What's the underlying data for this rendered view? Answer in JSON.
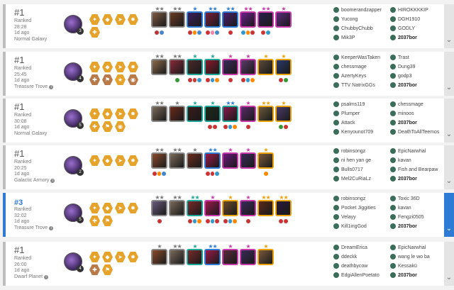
{
  "colors": {
    "gold_star": "#e8a20c",
    "silver_star": "#777777",
    "teal_star": "#1fa69a",
    "blue_star": "#2e7bd6",
    "pink_star": "#c73aa8"
  },
  "matches": [
    {
      "place": "#1",
      "queue": "Ranked",
      "duration": "28:28",
      "ago": "1d ago",
      "mode": "Normal Galaxy",
      "win": false,
      "avatar_level": "3",
      "traits": [
        {
          "tier": "gold",
          "icon": "✦"
        },
        {
          "tier": "gold",
          "icon": "◆"
        },
        {
          "tier": "gold",
          "icon": "➤"
        },
        {
          "tier": "gold",
          "icon": "✸"
        },
        {
          "tier": "gold",
          "icon": "✚"
        }
      ],
      "units": [
        {
          "c": "#7d5a42",
          "b": "#888",
          "s": "★★",
          "sc": "#777777",
          "items": [
            "#b33",
            "#48c"
          ]
        },
        {
          "c": "#6a3b22",
          "b": "#888",
          "s": "★★",
          "sc": "#777777",
          "items": []
        },
        {
          "c": "#3a1f5c",
          "b": "#2e7bd6",
          "s": "★",
          "sc": "#2e7bd6",
          "items": [
            "#c33",
            "#f80",
            "#48c"
          ]
        },
        {
          "c": "#7a1f3c",
          "b": "#2e7bd6",
          "s": "★★",
          "sc": "#2e7bd6",
          "items": [
            "#c33",
            "#e8a",
            "#48c"
          ]
        },
        {
          "c": "#4a1f6c",
          "b": "#2e7bd6",
          "s": "★★",
          "sc": "#2e7bd6",
          "items": [
            "#c33"
          ]
        },
        {
          "c": "#6a1f8c",
          "b": "#c73aa8",
          "s": "★★",
          "sc": "#c73aa8",
          "items": [
            "#39c",
            "#f80",
            "#c33"
          ]
        },
        {
          "c": "#2a1f4c",
          "b": "#c73aa8",
          "s": "★★",
          "sc": "#c73aa8",
          "items": [
            "#c33",
            "#39c"
          ]
        },
        {
          "c": "#5a2a7a",
          "b": "#c73aa8",
          "s": "★",
          "sc": "#c73aa8",
          "items": []
        }
      ],
      "players": [
        "boomerandzapper",
        "HIROKKKKIP",
        "Yucong",
        "DGH1910",
        "ChubbyChubb",
        "GODLY",
        "Mik3P",
        "2037bor"
      ]
    },
    {
      "place": "#1",
      "queue": "Ranked",
      "duration": "25:45",
      "ago": "1d ago",
      "mode": "Treasure Trove",
      "win": false,
      "avatar_level": "4",
      "traits": [
        {
          "tier": "gold",
          "icon": "✦"
        },
        {
          "tier": "gold",
          "icon": "◆"
        },
        {
          "tier": "gold",
          "icon": "➤"
        },
        {
          "tier": "gold",
          "icon": "✸"
        },
        {
          "tier": "bronze",
          "icon": "✚"
        },
        {
          "tier": "bronze",
          "icon": "⚑"
        },
        {
          "tier": "gold",
          "icon": "★"
        },
        {
          "tier": "bronze",
          "icon": "◉"
        }
      ],
      "units": [
        {
          "c": "#8a6a4a",
          "b": "#888",
          "s": "★★",
          "sc": "#777777",
          "items": []
        },
        {
          "c": "#8a2a3a",
          "b": "#888",
          "s": "★★",
          "sc": "#777777",
          "items": [
            "#393"
          ]
        },
        {
          "c": "#4a2a2a",
          "b": "#1fa69a",
          "s": "★",
          "sc": "#1fa69a",
          "items": [
            "#c33",
            "#c33",
            "#39c"
          ]
        },
        {
          "c": "#8a1a2a",
          "b": "#1fa69a",
          "s": "★",
          "sc": "#1fa69a",
          "items": [
            "#c33",
            "#39c",
            "#f80"
          ]
        },
        {
          "c": "#3a2a5a",
          "b": "#c73aa8",
          "s": "★",
          "sc": "#c73aa8",
          "items": [
            "#c33"
          ]
        },
        {
          "c": "#5a3a6a",
          "b": "#c73aa8",
          "s": "★",
          "sc": "#c73aa8",
          "items": [
            "#c33",
            "#39c",
            "#f80"
          ]
        },
        {
          "c": "#5a4a3a",
          "b": "#e8a20c",
          "s": "★",
          "sc": "#e8a20c",
          "items": []
        },
        {
          "c": "#2a3a6a",
          "b": "#e8a20c",
          "s": "★",
          "sc": "#e8a20c",
          "items": [
            "#c33",
            "#393"
          ]
        }
      ],
      "players": [
        "KeeperWasTaken",
        "Trast",
        "chessmage",
        "Dung39",
        "AzertyKeys",
        "godp3",
        "TTV NatrixGGs",
        "2037bor"
      ]
    },
    {
      "place": "#1",
      "queue": "Ranked",
      "duration": "30:08",
      "ago": "1d ago",
      "mode": "Normal Galaxy",
      "win": false,
      "avatar_level": "5",
      "traits": [
        {
          "tier": "gold",
          "icon": "✦"
        },
        {
          "tier": "gold",
          "icon": "◆"
        },
        {
          "tier": "gold",
          "icon": "➤"
        },
        {
          "tier": "gold",
          "icon": "✸"
        },
        {
          "tier": "gold",
          "icon": "✚"
        },
        {
          "tier": "gold",
          "icon": "⚑"
        },
        {
          "tier": "gold",
          "icon": "◉"
        }
      ],
      "units": [
        {
          "c": "#7a6a5a",
          "b": "#888",
          "s": "★★",
          "sc": "#777777",
          "items": []
        },
        {
          "c": "#6a2a1a",
          "b": "#888",
          "s": "★",
          "sc": "#777777",
          "items": []
        },
        {
          "c": "#3a1a1a",
          "b": "#1fa69a",
          "s": "★",
          "sc": "#1fa69a",
          "items": []
        },
        {
          "c": "#1a2a1a",
          "b": "#1fa69a",
          "s": "★",
          "sc": "#1fa69a",
          "items": [
            "#c33",
            "#c33"
          ]
        },
        {
          "c": "#8a1a4a",
          "b": "#1fa69a",
          "s": "★★",
          "sc": "#2e7bd6",
          "items": [
            "#c33",
            "#39c",
            "#f80"
          ]
        },
        {
          "c": "#5a2a6a",
          "b": "#c73aa8",
          "s": "★",
          "sc": "#c73aa8",
          "items": [
            "#c33"
          ]
        },
        {
          "c": "#6a5a3a",
          "b": "#e8a20c",
          "s": "★★",
          "sc": "#e8a20c",
          "items": []
        },
        {
          "c": "#4a3a6a",
          "b": "#e8a20c",
          "s": "★",
          "sc": "#e8a20c",
          "items": [
            "#393",
            "#c33"
          ]
        }
      ],
      "players": [
        "psalms119",
        "chessmage",
        "Plumper",
        "minoos",
        "Attack",
        "2037bor",
        "Kenyounot709",
        "DeathToAllTeemos"
      ]
    },
    {
      "place": "#1",
      "queue": "Ranked",
      "duration": "20:25",
      "ago": "1d ago",
      "mode": "Galactic Armory",
      "win": false,
      "avatar_level": "2",
      "traits": [
        {
          "tier": "gold",
          "icon": "✦"
        },
        {
          "tier": "gold",
          "icon": "◆"
        },
        {
          "tier": "gold",
          "icon": "➤"
        },
        {
          "tier": "gold",
          "icon": "✸"
        }
      ],
      "units": [
        {
          "c": "#8a4a2a",
          "b": "#888",
          "s": "★★",
          "sc": "#777777",
          "items": [
            "#c33",
            "#f80",
            "#48c"
          ]
        },
        {
          "c": "#7a6a5a",
          "b": "#888",
          "s": "★★",
          "sc": "#777777",
          "items": []
        },
        {
          "c": "#6a2a1a",
          "b": "#888",
          "s": "★",
          "sc": "#777777",
          "items": []
        },
        {
          "c": "#9a1a4a",
          "b": "#2e7bd6",
          "s": "★★",
          "sc": "#2e7bd6",
          "items": [
            "#c33",
            "#c33",
            "#39c"
          ]
        },
        {
          "c": "#6a1a7a",
          "b": "#c73aa8",
          "s": "★",
          "sc": "#c73aa8",
          "items": []
        },
        {
          "c": "#3a2a5a",
          "b": "#c73aa8",
          "s": "★",
          "sc": "#c73aa8",
          "items": []
        },
        {
          "c": "#7a5a3a",
          "b": "#e8a20c",
          "s": "★",
          "sc": "#e8a20c",
          "items": [
            "#f80"
          ]
        }
      ],
      "players": [
        "robinsongz",
        "EpicNarwhal",
        "ni hen yan ge",
        "kavan",
        "Bulls0717",
        "Fish and Bearpaw",
        "Mel2CuRiaLz",
        "2037bor"
      ]
    },
    {
      "place": "#3",
      "queue": "Ranked",
      "duration": "32:02",
      "ago": "1d ago",
      "mode": "Treasure Trove",
      "win": true,
      "avatar_level": "5",
      "traits": [
        {
          "tier": "gold",
          "icon": "✦"
        },
        {
          "tier": "gold",
          "icon": "◆"
        },
        {
          "tier": "gold",
          "icon": "➤"
        },
        {
          "tier": "gold",
          "icon": "✸"
        },
        {
          "tier": "gold",
          "icon": "✚"
        },
        {
          "tier": "gold",
          "icon": "⚑"
        }
      ],
      "units": [
        {
          "c": "#6a5a7a",
          "b": "#888",
          "s": "★★",
          "sc": "#777777",
          "items": [
            "#c33"
          ]
        },
        {
          "c": "#7a6a5a",
          "b": "#888",
          "s": "★★",
          "sc": "#777777",
          "items": []
        },
        {
          "c": "#7a2a2a",
          "b": "#1fa69a",
          "s": "★★",
          "sc": "#1fa69a",
          "items": [
            "#c33",
            "#39c",
            "#f80"
          ]
        },
        {
          "c": "#9a1a4a",
          "b": "#c73aa8",
          "s": "★",
          "sc": "#c73aa8",
          "items": [
            "#c33",
            "#39c",
            "#c33"
          ]
        },
        {
          "c": "#6a4a2a",
          "b": "#e8a20c",
          "s": "★",
          "sc": "#e8a20c",
          "items": [
            "#c33",
            "#39c",
            "#f80"
          ]
        },
        {
          "c": "#3a2a5a",
          "b": "#c73aa8",
          "s": "★",
          "sc": "#c73aa8",
          "items": [
            "#c33"
          ]
        },
        {
          "c": "#5a2a1a",
          "b": "#e8a20c",
          "s": "★★",
          "sc": "#e8a20c",
          "items": []
        },
        {
          "c": "#2a1a3a",
          "b": "#e8a20c",
          "s": "★★",
          "sc": "#e8a20c",
          "items": [
            "#c33",
            "#c33"
          ]
        }
      ],
      "players": [
        "robinsongz",
        "Toxic 36D",
        "Pocket Jiggities",
        "kavan",
        "Velayy",
        "Fengzi0505",
        "Kill1ingGod",
        "2037bor"
      ]
    },
    {
      "place": "#1",
      "queue": "Ranked",
      "duration": "26:00",
      "ago": "1d ago",
      "mode": "Dwarf Planet",
      "win": false,
      "avatar_level": "4",
      "traits": [
        {
          "tier": "gold",
          "icon": "✦"
        },
        {
          "tier": "gold",
          "icon": "◆"
        },
        {
          "tier": "gold",
          "icon": "➤"
        },
        {
          "tier": "gold",
          "icon": "✸"
        },
        {
          "tier": "bronze",
          "icon": "✚"
        },
        {
          "tier": "gold",
          "icon": "⚑"
        }
      ],
      "units": [
        {
          "c": "#8a4a2a",
          "b": "#888",
          "s": "★",
          "sc": "#777777",
          "items": []
        },
        {
          "c": "#7a6a5a",
          "b": "#888",
          "s": "★★",
          "sc": "#777777",
          "items": []
        },
        {
          "c": "#7a2a2a",
          "b": "#1fa69a",
          "s": "★",
          "sc": "#1fa69a",
          "items": []
        },
        {
          "c": "#9a1a4a",
          "b": "#2e7bd6",
          "s": "★★",
          "sc": "#2e7bd6",
          "items": []
        },
        {
          "c": "#5a2a3a",
          "b": "#c73aa8",
          "s": "★",
          "sc": "#c73aa8",
          "items": []
        },
        {
          "c": "#3a2a5a",
          "b": "#c73aa8",
          "s": "★",
          "sc": "#c73aa8",
          "items": []
        },
        {
          "c": "#7a5a3a",
          "b": "#e8a20c",
          "s": "★",
          "sc": "#e8a20c",
          "items": []
        }
      ],
      "players": [
        "DreamErica",
        "EpicNarwhal",
        "ddeckk",
        "wang le wo ba",
        "deathbycow",
        "Kessakü",
        "EdgiAllenPoetato",
        "2037bor"
      ]
    }
  ]
}
